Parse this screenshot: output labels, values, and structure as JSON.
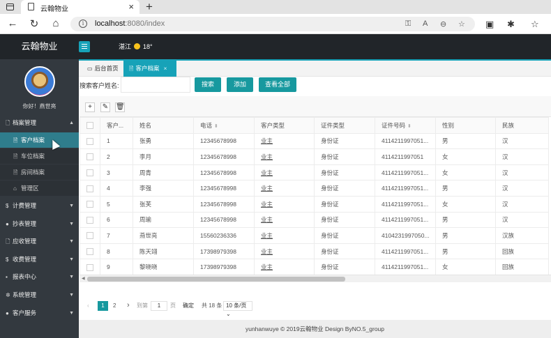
{
  "browser": {
    "tab_title": "云翰物业",
    "tab_close": "×",
    "new_tab": "+",
    "url_host": "localhost",
    "url_path": ":8080/index"
  },
  "app": {
    "brand": "云翰物业",
    "weather_city": "湛江",
    "weather_temp": "18°",
    "greeting": "你好！燕世亮"
  },
  "sidebar": {
    "items": [
      {
        "label": "档案管理",
        "icon": "file-icon"
      },
      {
        "label": "计费管理",
        "icon": "money-icon"
      },
      {
        "label": "抄表管理",
        "icon": "circle-icon"
      },
      {
        "label": "应收管理",
        "icon": "file-icon"
      },
      {
        "label": "收费管理",
        "icon": "money-icon"
      },
      {
        "label": "报表中心",
        "icon": "report-icon"
      },
      {
        "label": "系统管理",
        "icon": "gear-icon"
      },
      {
        "label": "客户服务",
        "icon": "user-icon"
      }
    ],
    "subitems": [
      {
        "label": "客户档案",
        "icon": "doc-icon"
      },
      {
        "label": "车位档案",
        "icon": "doc-icon"
      },
      {
        "label": "房间档案",
        "icon": "doc-icon"
      },
      {
        "label": "管理区",
        "icon": "home-icon"
      }
    ]
  },
  "content_tabs": {
    "home": "后台首页",
    "customer": "客户档案",
    "close": "×"
  },
  "search": {
    "label": "搜索客户姓名:",
    "value": "",
    "search_btn": "搜索",
    "add_btn": "添加",
    "all_btn": "查看全部"
  },
  "table": {
    "headers": [
      "客户...",
      "姓名",
      "电话",
      "客户类型",
      "证件类型",
      "证件号码",
      "性别",
      "民族"
    ],
    "rows": [
      [
        "1",
        "张勇",
        "12345678998",
        "业主",
        "身份证",
        "4114211997051...",
        "男",
        "汉"
      ],
      [
        "2",
        "李月",
        "12345678998",
        "业主",
        "身份证",
        "4114211997051",
        "女",
        "汉"
      ],
      [
        "3",
        "周青",
        "12345678998",
        "业主",
        "身份证",
        "4114211997051...",
        "女",
        "汉"
      ],
      [
        "4",
        "李强",
        "12345678998",
        "业主",
        "身份证",
        "4114211997051...",
        "男",
        "汉"
      ],
      [
        "5",
        "张芙",
        "12345678998",
        "业主",
        "身份证",
        "4114211997051...",
        "女",
        "汉"
      ],
      [
        "6",
        "周瑜",
        "12345678998",
        "业主",
        "身份证",
        "4114211997051...",
        "男",
        "汉"
      ],
      [
        "7",
        "燕世亮",
        "15560236336",
        "业主",
        "身份证",
        "4104231997050...",
        "男",
        "汉族"
      ],
      [
        "8",
        "陈天翊",
        "17398979398",
        "业主",
        "身份证",
        "4114211997051...",
        "男",
        "回族"
      ],
      [
        "9",
        "黎晓晓",
        "17398979398",
        "业主",
        "身份证",
        "4114211997051...",
        "女",
        "回族"
      ]
    ]
  },
  "pager": {
    "page1": "1",
    "page2": "2",
    "goto": "到第",
    "page_input": "1",
    "page_unit": "页",
    "confirm": "确定",
    "total": "共 18 条",
    "per_page": "10 条/页"
  },
  "footer": "yunhanwuye © 2019云翰物业 Design ByNO.5_group"
}
